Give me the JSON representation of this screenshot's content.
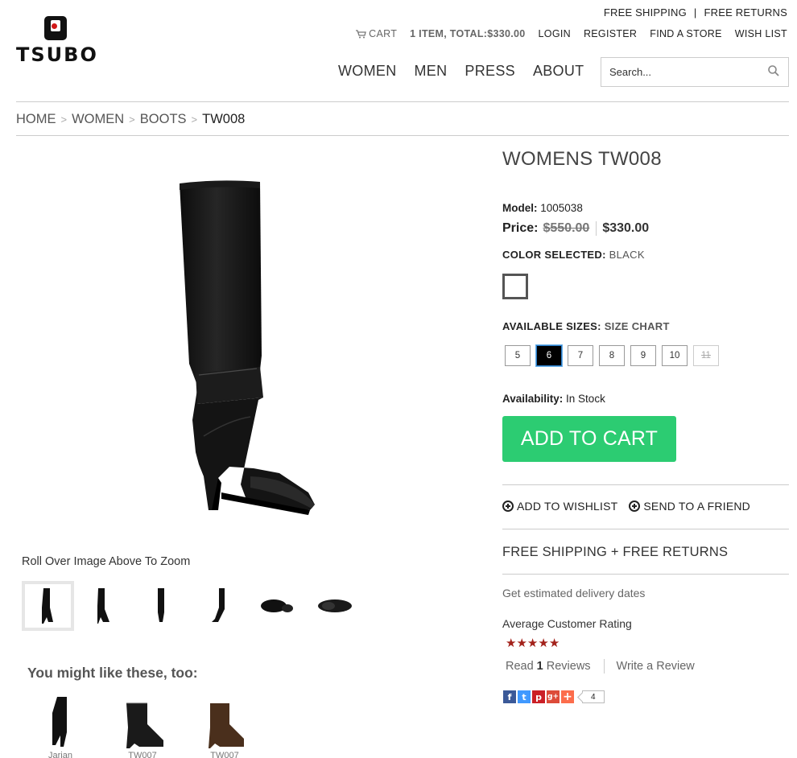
{
  "brand": {
    "name": "TSUBO"
  },
  "topbar": {
    "shipping": "FREE SHIPPING",
    "divider": "|",
    "returns": "FREE RETURNS"
  },
  "utility": {
    "cart": "CART",
    "total": "1 ITEM, TOTAL:$330.00",
    "login": "LOGIN",
    "register": "REGISTER",
    "find_store": "FIND A STORE",
    "wishlist": "WISH LIST"
  },
  "nav": [
    {
      "label": "WOMEN"
    },
    {
      "label": "MEN"
    },
    {
      "label": "PRESS"
    },
    {
      "label": "ABOUT"
    }
  ],
  "search": {
    "placeholder": "Search..."
  },
  "breadcrumb": {
    "home": "HOME",
    "women": "WOMEN",
    "boots": "BOOTS",
    "current": "TW008",
    "sep": ">"
  },
  "gallery": {
    "zoom_hint": "Roll Over Image Above To Zoom"
  },
  "recommend": {
    "title": "You might like these, too:",
    "items": [
      {
        "name": "Jarian"
      },
      {
        "name": "TW007"
      },
      {
        "name": "TW007"
      }
    ]
  },
  "product": {
    "title": "WOMENS TW008",
    "model_label": "Model:",
    "model": "1005038",
    "price_label": "Price:",
    "old_price": "$550.00",
    "new_price": "$330.00",
    "color_label": "COLOR SELECTED:",
    "color_value": "BLACK",
    "sizes_label": "AVAILABLE SIZES:",
    "size_chart": "SIZE CHART",
    "sizes": [
      {
        "label": "5"
      },
      {
        "label": "6"
      },
      {
        "label": "7"
      },
      {
        "label": "8"
      },
      {
        "label": "9"
      },
      {
        "label": "10"
      },
      {
        "label": "11"
      }
    ],
    "selected_size": "6",
    "unavailable_size": "11",
    "availability_label": "Availability:",
    "availability": "In Stock",
    "add_to_cart": "ADD TO CART",
    "add_wishlist": "ADD TO WISHLIST",
    "send_friend": "SEND TO A FRIEND",
    "shipping_returns": "FREE SHIPPING + FREE RETURNS",
    "delivery": "Get estimated delivery dates",
    "rating_label": "Average Customer Rating",
    "rating": 5,
    "reviews_prefix": "Read",
    "reviews_count": "1",
    "reviews_suffix": "Reviews",
    "write_review": "Write a Review",
    "share_count": "4"
  },
  "colors": {
    "accent": "#2ccc72",
    "star": "#a3221b"
  }
}
